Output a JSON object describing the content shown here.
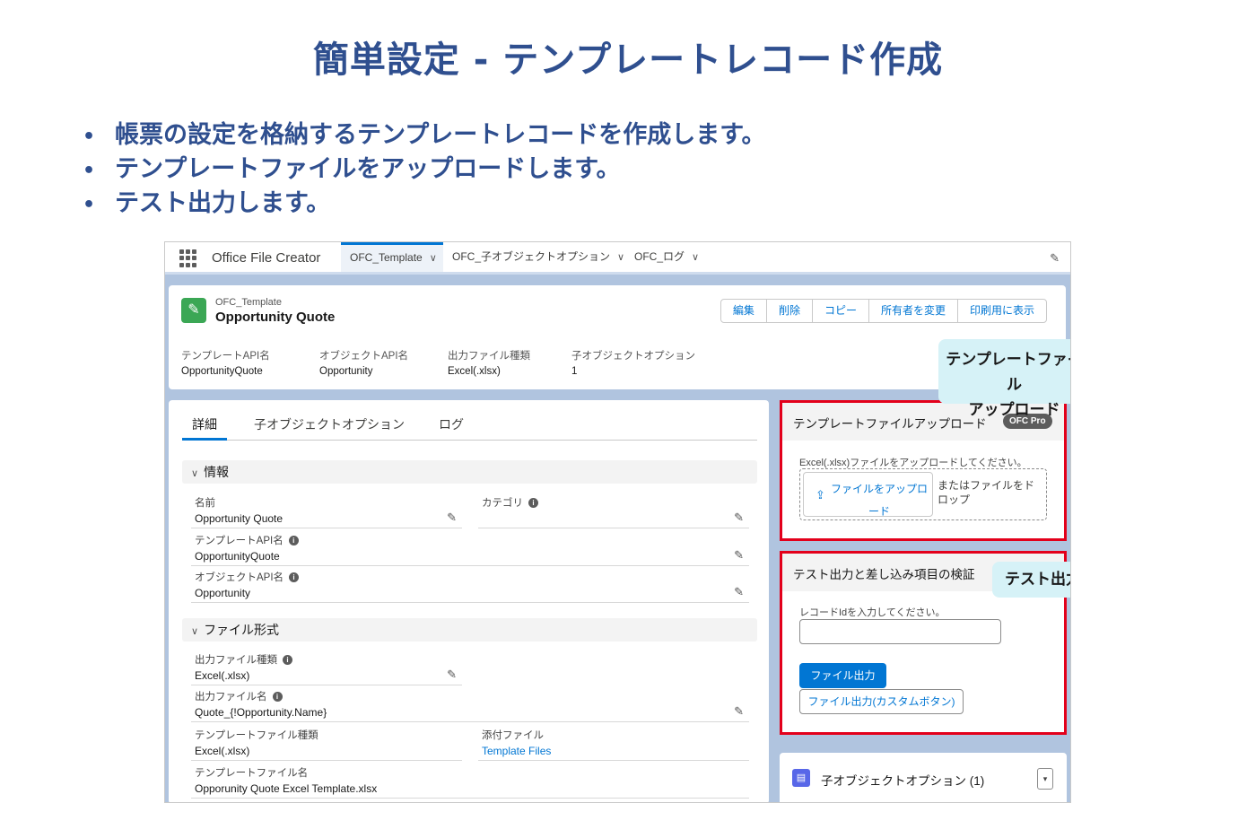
{
  "slide": {
    "title": "簡単設定 - テンプレートレコード作成",
    "bullets": [
      "帳票の設定を格納するテンプレートレコードを作成します。",
      "テンプレートファイルをアップロードします。",
      "テスト出力します。"
    ],
    "bullet_glyph": "•"
  },
  "nav": {
    "app_name": "Office File Creator",
    "tabs": [
      {
        "label": "OFC_Template",
        "active": true
      },
      {
        "label": "OFC_子オブジェクトオプション",
        "active": false
      },
      {
        "label": "OFC_ログ",
        "active": false
      }
    ],
    "chevron": "∨",
    "edit_icon": "✎"
  },
  "record": {
    "icon": "✎",
    "object_label": "OFC_Template",
    "name": "Opportunity Quote",
    "actions": [
      "編集",
      "削除",
      "コピー",
      "所有者を変更",
      "印刷用に表示"
    ],
    "highlights": [
      {
        "label": "テンプレートAPI名",
        "value": "OpportunityQuote"
      },
      {
        "label": "オブジェクトAPI名",
        "value": "Opportunity"
      },
      {
        "label": "出力ファイル種類",
        "value": "Excel(.xlsx)"
      },
      {
        "label": "子オブジェクトオプション",
        "value": "1"
      }
    ]
  },
  "callouts": {
    "upload_line1": "テンプレートファイル",
    "upload_line2": "アップロード",
    "test": "テスト出力"
  },
  "detail": {
    "tabs": [
      "詳細",
      "子オブジェクトオプション",
      "ログ"
    ],
    "sections": {
      "info": "情報",
      "file_format": "ファイル形式"
    },
    "fields": {
      "name": {
        "label": "名前",
        "value": "Opportunity Quote"
      },
      "category": {
        "label": "カテゴリ",
        "value": ""
      },
      "template_api": {
        "label": "テンプレートAPI名",
        "value": "OpportunityQuote"
      },
      "object_api": {
        "label": "オブジェクトAPI名",
        "value": "Opportunity"
      },
      "output_type": {
        "label": "出力ファイル種類",
        "value": "Excel(.xlsx)"
      },
      "output_name": {
        "label": "出力ファイル名",
        "value": "Quote_{!Opportunity.Name}"
      },
      "template_type": {
        "label": "テンプレートファイル種類",
        "value": "Excel(.xlsx)"
      },
      "attachment": {
        "label": "添付ファイル",
        "value": "Template Files"
      },
      "template_name": {
        "label": "テンプレートファイル名",
        "value": "Opporunity Quote Excel Template.xlsx"
      }
    },
    "info_icon": "i",
    "edit_icon": "✎",
    "chevron": "∨"
  },
  "upload": {
    "title": "テンプレートファイルアップロード",
    "badge": "OFC Pro",
    "hint": "Excel(.xlsx)ファイルをアップロードしてください。",
    "button": "ファイルをアップロード",
    "upload_icon": "⇪",
    "drop_text": "またはファイルをドロップ"
  },
  "test": {
    "title": "テスト出力と差し込み項目の検証",
    "input_label": "レコードIdを入力してください。",
    "input_value": "",
    "primary_button": "ファイル出力",
    "secondary_button": "ファイル出力(カスタムボタン)"
  },
  "related": {
    "title": "子オブジェクトオプション (1)",
    "icon": "▤",
    "menu_icon": "▾"
  }
}
